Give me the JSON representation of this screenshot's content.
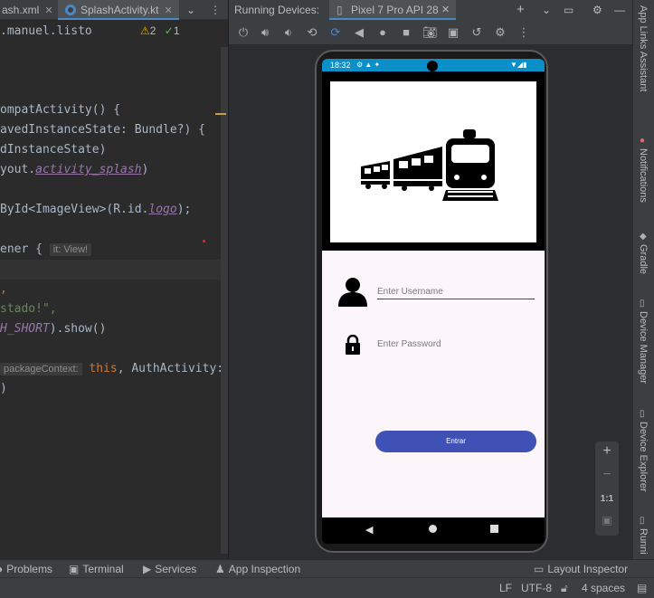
{
  "tabs": [
    {
      "label": "ash.xml",
      "close": "✕"
    },
    {
      "label": "SplashActivity.kt",
      "close": "✕"
    }
  ],
  "tab_overflow": "⌄",
  "editor": {
    "package_fragment": ".manuel.listo",
    "warnings_count": "2",
    "checks_count": "1",
    "lines": [
      {
        "a": "ompatActivity() {"
      },
      {
        "a": "avedInstanceState: Bundle?) {"
      },
      {
        "a": "dInstanceState)"
      },
      {
        "a": "yout.",
        "b": "activity_splash",
        "c": ")"
      },
      {
        "a": "ById<ImageView>(R.id.",
        "b": "logo",
        "c": ");"
      },
      {
        "a": "ener { ",
        "hint": "it: View!"
      },
      {
        "a": ","
      },
      {
        "a": "stado!\","
      },
      {
        "b": "H_SHORT",
        "c": ").show()"
      },
      {
        "hint": "packageContext:",
        "kw": " this",
        "c": ", AuthActivity:"
      },
      {
        "a": ")"
      }
    ]
  },
  "device_panel": {
    "title": "Running Devices:",
    "device_tab": "Pixel 7 Pro API 28",
    "device_close": "✕",
    "header_icons": [
      "plus-icon",
      "chevron-down-icon",
      "window-icon",
      "gear-icon",
      "minimize-icon"
    ]
  },
  "phone": {
    "time": "18:32",
    "username_placeholder": "Enter Username",
    "password_placeholder": "Enter Password",
    "enter_button": "Entrar"
  },
  "zoom": {
    "plus": "+",
    "minus": "−",
    "ratio": "1:1"
  },
  "right_strip": [
    "App Links Assistant",
    "Notifications",
    "Gradle",
    "Device Manager",
    "Device Explorer",
    "Runni"
  ],
  "bottom_tools": [
    "Problems",
    "Terminal",
    "Services",
    "App Inspection",
    "Layout Inspector"
  ],
  "status": {
    "line_ending": "LF",
    "encoding": "UTF-8",
    "indent": "4 spaces"
  },
  "colors": {
    "accent": "#3f51b5",
    "statusbar": "#0a8fc8",
    "background": "#2b2b2b"
  }
}
